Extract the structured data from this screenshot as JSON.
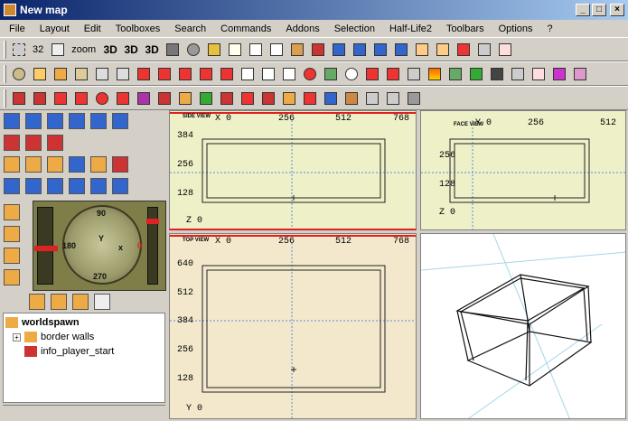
{
  "window": {
    "title": "New map"
  },
  "menu": [
    "File",
    "Layout",
    "Edit",
    "Toolboxes",
    "Search",
    "Commands",
    "Addons",
    "Selection",
    "Half-Life2",
    "Toolbars",
    "Options",
    "?"
  ],
  "toolbar1": {
    "grid_value": "32",
    "zoom_label": "zoom"
  },
  "viewports": {
    "side": {
      "label": "SIDE VIEW",
      "x_ticks": [
        "0",
        "256",
        "512",
        "768"
      ],
      "y_ticks": [
        "384",
        "256",
        "128",
        "0"
      ],
      "x_axis": "X",
      "y_axis": "Z"
    },
    "face": {
      "label": "FACE VIEW",
      "x_ticks": [
        "0",
        "256",
        "512"
      ],
      "y_ticks": [
        "256",
        "128",
        "0"
      ],
      "x_axis": "Y",
      "y_axis": "Z"
    },
    "top": {
      "label": "TOP VIEW",
      "x_ticks": [
        "0",
        "256",
        "512",
        "768"
      ],
      "y_ticks": [
        "640",
        "512",
        "384",
        "256",
        "128",
        "0"
      ],
      "x_axis": "X",
      "y_axis": "Y"
    }
  },
  "compass": {
    "n": "90",
    "s": "270",
    "w": "180",
    "e": "0",
    "x_label": "x",
    "y_label": "Y"
  },
  "tree": {
    "root": "worldspawn",
    "items": [
      "border walls",
      "info_player_start"
    ]
  },
  "colors": {
    "title_start": "#0a246a",
    "title_end": "#a6caf0",
    "viewport_bg_side": "#eef0c8",
    "viewport_bg_top": "#f3e8cc",
    "active_border": "#e02020"
  }
}
